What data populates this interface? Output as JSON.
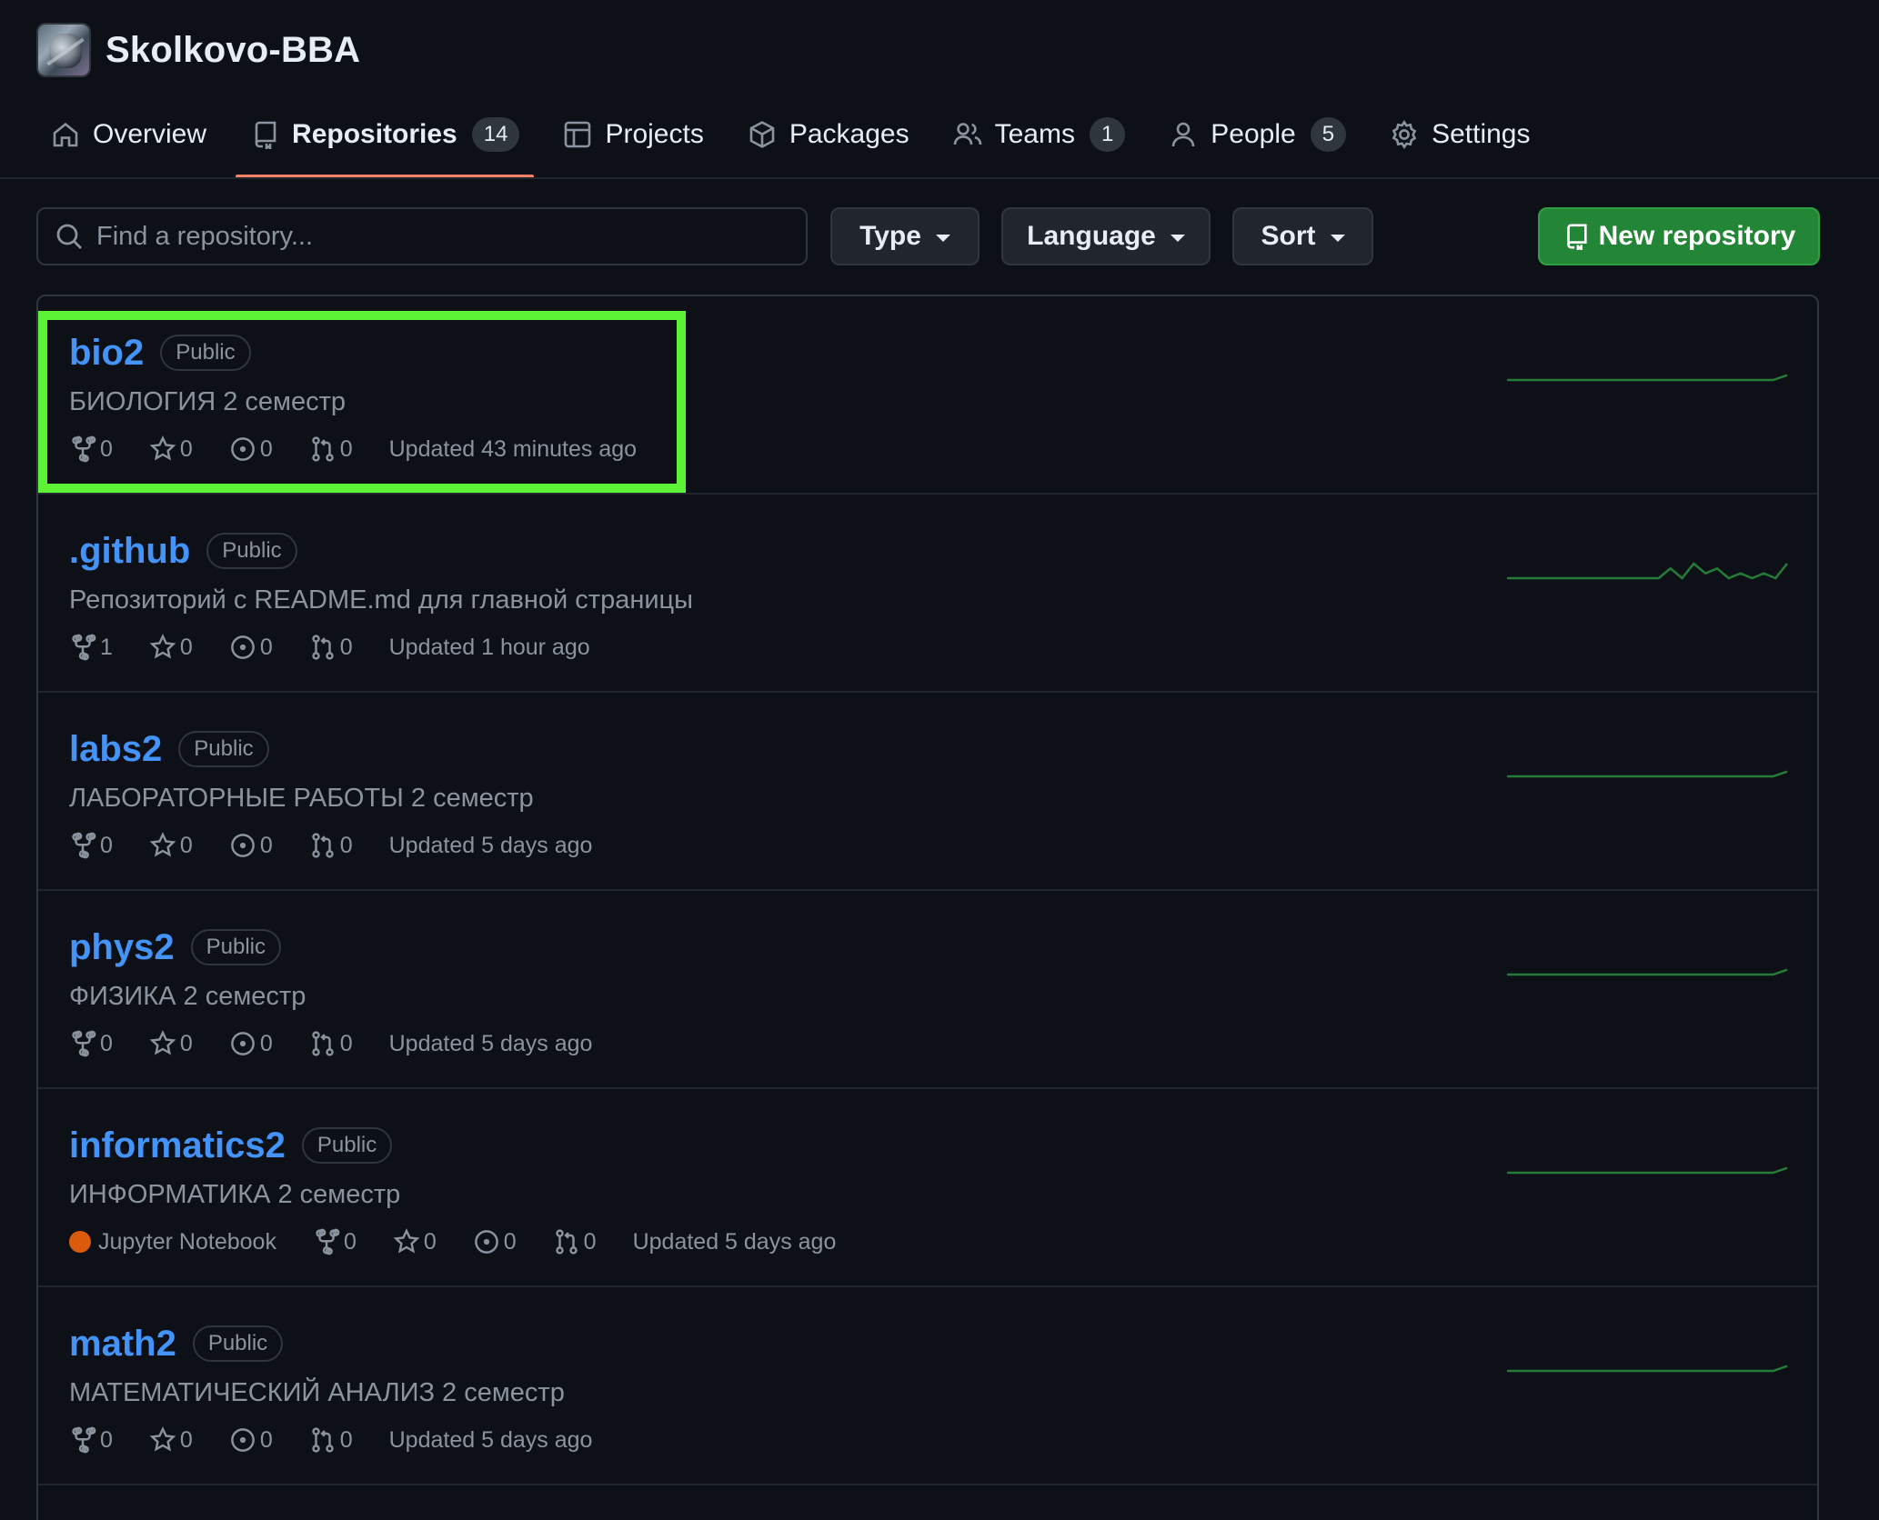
{
  "org": {
    "name": "Skolkovo-BBA"
  },
  "tabs": [
    {
      "label": "Overview",
      "icon": "home-icon"
    },
    {
      "label": "Repositories",
      "icon": "repo-icon",
      "count": "14",
      "active": true
    },
    {
      "label": "Projects",
      "icon": "table-icon"
    },
    {
      "label": "Packages",
      "icon": "package-icon"
    },
    {
      "label": "Teams",
      "icon": "people-icon",
      "count": "1"
    },
    {
      "label": "People",
      "icon": "person-icon",
      "count": "5"
    },
    {
      "label": "Settings",
      "icon": "gear-icon"
    }
  ],
  "filters": {
    "search_placeholder": "Find a repository...",
    "type_label": "Type",
    "language_label": "Language",
    "sort_label": "Sort",
    "new_repo_label": "New repository"
  },
  "repos": [
    {
      "name": "bio2",
      "visibility": "Public",
      "description": "БИОЛОГИЯ 2 семестр",
      "forks": "0",
      "stars": "0",
      "issues": "0",
      "pulls": "0",
      "updated": "Updated 43 minutes ago",
      "language": "",
      "activity": [
        0,
        0,
        0,
        0,
        0,
        0,
        0,
        0,
        0,
        0,
        0,
        0,
        0,
        0,
        0,
        0,
        0,
        0,
        0,
        0,
        1
      ]
    },
    {
      "name": ".github",
      "visibility": "Public",
      "description": "Репозиторий с README.md для главной страницы",
      "forks": "1",
      "stars": "0",
      "issues": "0",
      "pulls": "0",
      "updated": "Updated 1 hour ago",
      "language": "",
      "activity": [
        0,
        0,
        0,
        0,
        0,
        0,
        0,
        0,
        0,
        0,
        0,
        0,
        0,
        0,
        2,
        0,
        3,
        1,
        2,
        0,
        1,
        0,
        1,
        0,
        3
      ]
    },
    {
      "name": "labs2",
      "visibility": "Public",
      "description": "ЛАБОРАТОРНЫЕ РАБОТЫ 2 семестр",
      "forks": "0",
      "stars": "0",
      "issues": "0",
      "pulls": "0",
      "updated": "Updated 5 days ago",
      "language": "",
      "activity": [
        0,
        0,
        0,
        0,
        0,
        0,
        0,
        0,
        0,
        0,
        0,
        0,
        0,
        0,
        0,
        0,
        0,
        0,
        0,
        0,
        1
      ]
    },
    {
      "name": "phys2",
      "visibility": "Public",
      "description": "ФИЗИКА 2 семестр",
      "forks": "0",
      "stars": "0",
      "issues": "0",
      "pulls": "0",
      "updated": "Updated 5 days ago",
      "language": "",
      "activity": [
        0,
        0,
        0,
        0,
        0,
        0,
        0,
        0,
        0,
        0,
        0,
        0,
        0,
        0,
        0,
        0,
        0,
        0,
        0,
        0,
        1
      ]
    },
    {
      "name": "informatics2",
      "visibility": "Public",
      "description": "ИНФОРМАТИКА 2 семестр",
      "forks": "0",
      "stars": "0",
      "issues": "0",
      "pulls": "0",
      "updated": "Updated 5 days ago",
      "language": "Jupyter Notebook",
      "language_color": "#da5b0b",
      "activity": [
        0,
        0,
        0,
        0,
        0,
        0,
        0,
        0,
        0,
        0,
        0,
        0,
        0,
        0,
        0,
        0,
        0,
        0,
        0,
        0,
        1
      ]
    },
    {
      "name": "math2",
      "visibility": "Public",
      "description": "МАТЕМАТИЧЕСКИЙ АНАЛИЗ 2 семестр",
      "forks": "0",
      "stars": "0",
      "issues": "0",
      "pulls": "0",
      "updated": "Updated 5 days ago",
      "language": "",
      "activity": [
        0,
        0,
        0,
        0,
        0,
        0,
        0,
        0,
        0,
        0,
        0,
        0,
        0,
        0,
        0,
        0,
        0,
        0,
        0,
        0,
        1
      ]
    }
  ],
  "colors": {
    "accent_link": "#4493f8",
    "active_tab_underline": "#f78166",
    "primary_button": "#238636",
    "sparkline": "#2ea043",
    "highlight": "#5cf235"
  }
}
